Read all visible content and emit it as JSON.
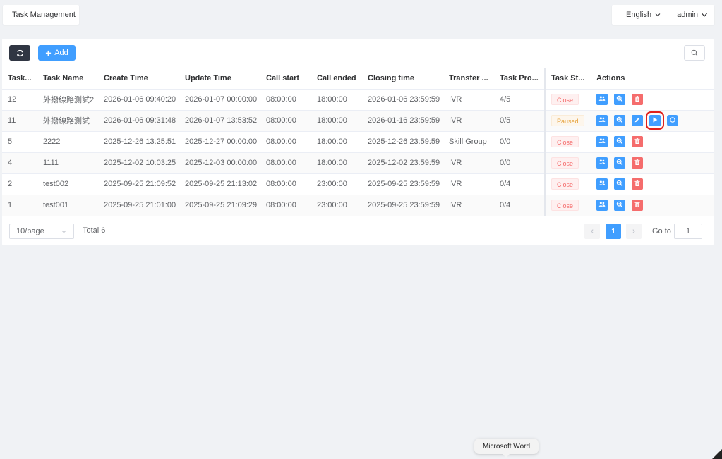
{
  "header": {
    "tab_label": "Task Management",
    "language_label": "English",
    "user_label": "admin"
  },
  "toolbar": {
    "add_label": "Add",
    "refresh_icon": "refresh-icon",
    "search_icon": "search-icon"
  },
  "table": {
    "columns": [
      "Task...",
      "Task Name",
      "Create Time",
      "Update Time",
      "Call start",
      "Call ended",
      "Closing time",
      "Transfer ...",
      "Task Pro...",
      "Task St...",
      "Actions"
    ],
    "rows": [
      {
        "id": "12",
        "name": "外撥線路測試2",
        "create": "2026-01-06 09:40:20",
        "update": "2026-01-07 00:00:00",
        "start": "08:00:00",
        "end": "18:00:00",
        "closing": "2026-01-06 23:59:59",
        "transfer": "IVR",
        "progress": "4/5",
        "status": "Close"
      },
      {
        "id": "11",
        "name": "外撥線路測試",
        "create": "2026-01-06 09:31:48",
        "update": "2026-01-07 13:53:52",
        "start": "08:00:00",
        "end": "18:00:00",
        "closing": "2026-01-16 23:59:59",
        "transfer": "IVR",
        "progress": "0/5",
        "status": "Paused"
      },
      {
        "id": "5",
        "name": "2222",
        "create": "2025-12-26 13:25:51",
        "update": "2025-12-27 00:00:00",
        "start": "08:00:00",
        "end": "18:00:00",
        "closing": "2025-12-26 23:59:59",
        "transfer": "Skill Group",
        "progress": "0/0",
        "status": "Close"
      },
      {
        "id": "4",
        "name": "1111",
        "create": "2025-12-02 10:03:25",
        "update": "2025-12-03 00:00:00",
        "start": "08:00:00",
        "end": "18:00:00",
        "closing": "2025-12-02 23:59:59",
        "transfer": "IVR",
        "progress": "0/0",
        "status": "Close"
      },
      {
        "id": "2",
        "name": "test002",
        "create": "2025-09-25 21:09:52",
        "update": "2025-09-25 21:13:02",
        "start": "08:00:00",
        "end": "23:00:00",
        "closing": "2025-09-25 23:59:59",
        "transfer": "IVR",
        "progress": "0/4",
        "status": "Close"
      },
      {
        "id": "1",
        "name": "test001",
        "create": "2025-09-25 21:01:00",
        "update": "2025-09-25 21:09:29",
        "start": "08:00:00",
        "end": "23:00:00",
        "closing": "2025-09-25 23:59:59",
        "transfer": "IVR",
        "progress": "0/4",
        "status": "Close"
      }
    ]
  },
  "pagination": {
    "page_size": "10/page",
    "total": "Total 6",
    "current_page": "1",
    "goto_label": "Go to",
    "goto_value": "1"
  },
  "tooltip": "Microsoft Word",
  "colors": {
    "primary": "#409eff",
    "danger": "#f56c6c",
    "warning": "#e6a23c",
    "dark": "#303643",
    "highlight": "#e0201b"
  }
}
